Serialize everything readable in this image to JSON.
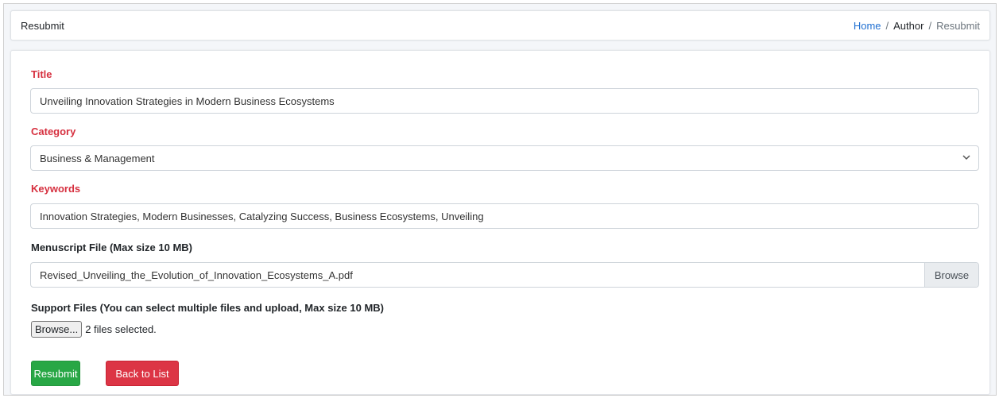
{
  "header": {
    "title": "Resubmit",
    "breadcrumb": {
      "home": "Home",
      "author": "Author",
      "current": "Resubmit",
      "separator": "/"
    }
  },
  "form": {
    "title_label": "Title",
    "title_value": "Unveiling Innovation Strategies in Modern Business Ecosystems",
    "category_label": "Category",
    "category_value": "Business & Management",
    "keywords_label": "Keywords",
    "keywords_value": "Innovation Strategies, Modern Businesses, Catalyzing Success, Business Ecosystems, Unveiling",
    "manuscript_label": "Menuscript File (Max size 10 MB)",
    "manuscript_value": "Revised_Unveiling_the_Evolution_of_Innovation_Ecosystems_A.pdf",
    "manuscript_browse": "Browse",
    "support_label": "Support Files (You can select multiple files and upload, Max size 10 MB)",
    "support_browse": "Browse...",
    "support_status": "2 files selected."
  },
  "actions": {
    "resubmit": "Resubmit",
    "back": "Back to List"
  },
  "colors": {
    "label_red": "#d6303f",
    "link_blue": "#1f6fd1",
    "success": "#28a745",
    "danger": "#dc3545"
  },
  "icons": {
    "select_arrow": "chevron-down-icon"
  }
}
